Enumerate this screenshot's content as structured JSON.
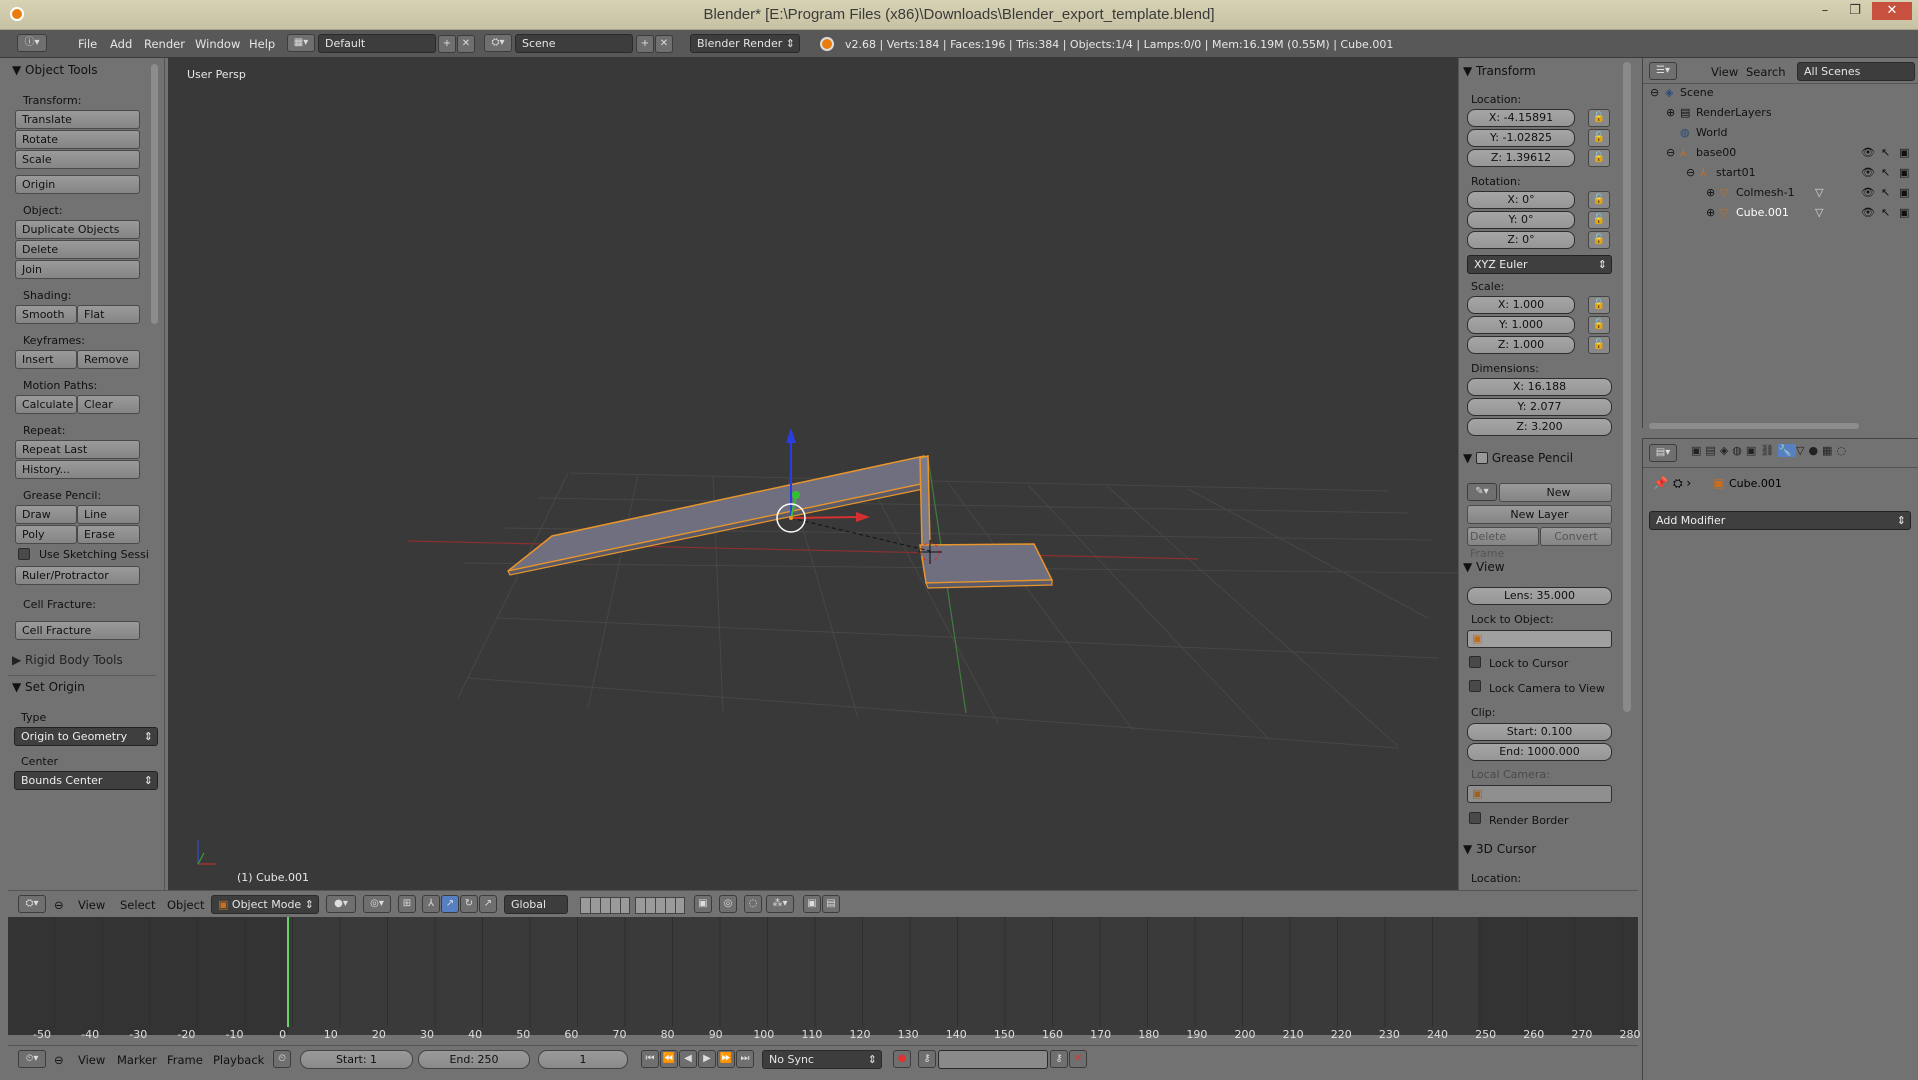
{
  "window": {
    "title": "Blender* [E:\\Program Files (x86)\\Downloads\\Blender_export_template.blend]",
    "min": "–",
    "max": "❐",
    "close": "✕"
  },
  "infobar": {
    "menus": [
      "File",
      "Add",
      "Render",
      "Window",
      "Help"
    ],
    "layout": "Default",
    "scene": "Scene",
    "engine": "Blender Render",
    "stats": "v2.68 | Verts:184 | Faces:196 | Tris:384 | Objects:1/4 | Lamps:0/0 | Mem:16.19M (0.55M) | Cube.001"
  },
  "toolshelf": {
    "title": "Object Tools",
    "transform_label": "Transform:",
    "translate": "Translate",
    "rotate": "Rotate",
    "scale": "Scale",
    "origin": "Origin",
    "object_label": "Object:",
    "duplicate": "Duplicate Objects",
    "delete": "Delete",
    "join": "Join",
    "shading_label": "Shading:",
    "smooth": "Smooth",
    "flat": "Flat",
    "keyframes_label": "Keyframes:",
    "insert": "Insert",
    "remove": "Remove",
    "motion_label": "Motion Paths:",
    "calculate": "Calculate",
    "clear": "Clear",
    "repeat_label": "Repeat:",
    "repeat_last": "Repeat Last",
    "history": "History...",
    "grease_label": "Grease Pencil:",
    "draw": "Draw",
    "line": "Line",
    "poly": "Poly",
    "erase": "Erase",
    "sketching": "Use Sketching Sessi",
    "ruler": "Ruler/Protractor",
    "cellfracture_label": "Cell Fracture:",
    "cellfracture": "Cell Fracture",
    "rigid": "Rigid Body Tools",
    "set_origin": "Set Origin",
    "type_label": "Type",
    "type_value": "Origin to Geometry",
    "center_label": "Center",
    "center_value": "Bounds Center"
  },
  "viewport": {
    "view_name": "User Persp",
    "object_label": "(1) Cube.001"
  },
  "npanel": {
    "transform": "Transform",
    "location_label": "Location:",
    "loc_x": "X: -4.15891",
    "loc_y": "Y: -1.02825",
    "loc_z": "Z: 1.39612",
    "rotation_label": "Rotation:",
    "rot_x": "X: 0°",
    "rot_y": "Y: 0°",
    "rot_z": "Z: 0°",
    "rot_mode": "XYZ Euler",
    "scale_label": "Scale:",
    "sc_x": "X: 1.000",
    "sc_y": "Y: 1.000",
    "sc_z": "Z: 1.000",
    "dimensions_label": "Dimensions:",
    "dim_x": "X: 16.188",
    "dim_y": "Y: 2.077",
    "dim_z": "Z: 3.200",
    "grease_pencil": "Grease Pencil",
    "new": "New",
    "new_layer": "New Layer",
    "delete_frame": "Delete Frame",
    "convert": "Convert",
    "view": "View",
    "lens": "Lens: 35.000",
    "lock_to_object": "Lock to Object:",
    "lock_to_cursor": "Lock to Cursor",
    "lock_camera": "Lock Camera to View",
    "clip_label": "Clip:",
    "clip_start": "Start: 0.100",
    "clip_end": "End: 1000.000",
    "local_camera": "Local Camera:",
    "render_border": "Render Border",
    "cursor3d": "3D Cursor",
    "cursor_location": "Location:"
  },
  "outliner": {
    "view": "View",
    "search": "Search",
    "filter": "All Scenes",
    "items": [
      "Scene",
      "RenderLayers",
      "World",
      "base00",
      "start01",
      "Colmesh-1",
      "Cube.001"
    ]
  },
  "properties": {
    "object": "Cube.001",
    "add_modifier": "Add Modifier"
  },
  "vpheader": {
    "view": "View",
    "select": "Select",
    "object": "Object",
    "mode": "Object Mode",
    "orientation": "Global"
  },
  "timeline": {
    "ticks": [
      "-50",
      "-40",
      "-30",
      "-20",
      "-10",
      "0",
      "10",
      "20",
      "30",
      "40",
      "50",
      "60",
      "70",
      "80",
      "90",
      "100",
      "110",
      "120",
      "130",
      "140",
      "150",
      "160",
      "170",
      "180",
      "190",
      "200",
      "210",
      "220",
      "230",
      "240",
      "250",
      "260",
      "270",
      "280"
    ],
    "current_frame": 0
  },
  "tlheader": {
    "view": "View",
    "marker": "Marker",
    "frame": "Frame",
    "playback": "Playback",
    "start": "Start: 1",
    "end": "End: 250",
    "current": "1",
    "sync": "No Sync"
  }
}
